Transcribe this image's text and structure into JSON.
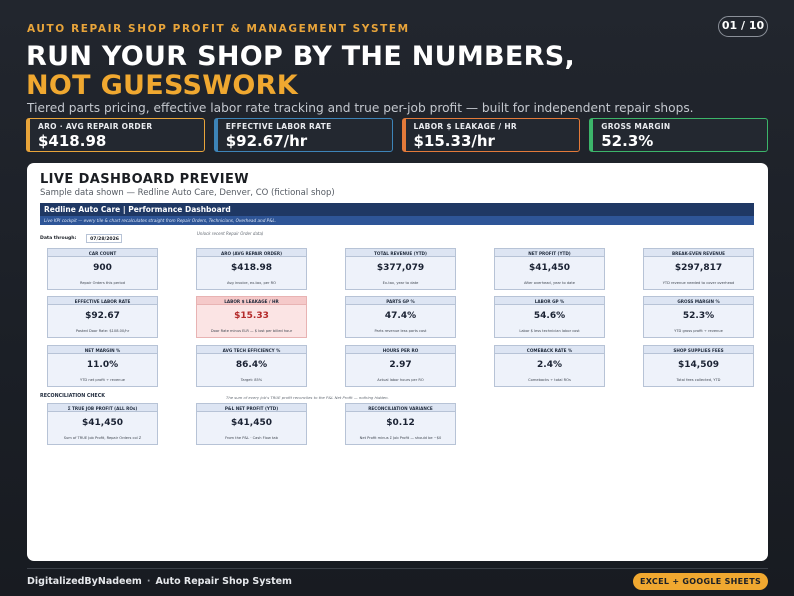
{
  "header": {
    "eyebrow": "AUTO REPAIR SHOP PROFIT & MANAGEMENT SYSTEM",
    "page_indicator": "01 / 10",
    "headline_line1": "RUN YOUR SHOP BY THE NUMBERS,",
    "headline_line2": "NOT GUESSWORK",
    "subhead": "Tiered parts pricing, effective labor rate tracking and true per-job profit — built for independent repair shops."
  },
  "kpis": [
    {
      "label": "ARO · AVG REPAIR ORDER",
      "value": "$418.98",
      "color": "#e8a43a"
    },
    {
      "label": "EFFECTIVE LABOR RATE",
      "value": "$92.67/hr",
      "color": "#3d84b8"
    },
    {
      "label": "LABOR $ LEAKAGE / HR",
      "value": "$15.33/hr",
      "color": "#e37a3a"
    },
    {
      "label": "GROSS MARGIN",
      "value": "52.3%",
      "color": "#3cb56a"
    }
  ],
  "panel": {
    "title": "LIVE DASHBOARD PREVIEW",
    "subtitle": "Sample data shown — Redline Auto Care, Denver, CO (fictional shop)",
    "dashboard_header": "Redline Auto Care  |  Performance Dashboard",
    "dashboard_subheader": "Live KPI cockpit — every tile & chart recalculates straight from Repair Orders, Technicians, Overhead and P&L.",
    "date_label": "Data through:",
    "date_value": "07/28/2026",
    "note_top": "Unlock recent Repair Order data)",
    "tiles": [
      {
        "label": "CAR COUNT",
        "value": "900",
        "note": "Repair Orders this period"
      },
      {
        "label": "ARO (AVG REPAIR ORDER)",
        "value": "$418.98",
        "note": "Avg invoice, ex-tax, per RO"
      },
      {
        "label": "TOTAL REVENUE (YTD)",
        "value": "$377,079",
        "note": "Ex-tax, year to date"
      },
      {
        "label": "NET PROFIT (YTD)",
        "value": "$41,450",
        "note": "After overhead, year to date"
      },
      {
        "label": "BREAK-EVEN REVENUE",
        "value": "$297,817",
        "note": "YTD revenue needed to cover overhead"
      },
      {
        "label": "EFFECTIVE LABOR RATE",
        "value": "$92.67",
        "note": "Posted Door Rate: $108.00/hr"
      },
      {
        "label": "LABOR $ LEAKAGE / HR",
        "value": "$15.33",
        "note": "Door Rate minus ELR — $ lost per billed hour"
      },
      {
        "label": "PARTS GP %",
        "value": "47.4%",
        "note": "Parts revenue less parts cost"
      },
      {
        "label": "LABOR GP %",
        "value": "54.6%",
        "note": "Labor $ less technician labor cost"
      },
      {
        "label": "GROSS MARGIN %",
        "value": "52.3%",
        "note": "YTD gross profit ÷ revenue"
      },
      {
        "label": "NET MARGIN %",
        "value": "11.0%",
        "note": "YTD net profit ÷ revenue"
      },
      {
        "label": "AVG TECH EFFICIENCY %",
        "value": "86.4%",
        "note": "Target: 85%"
      },
      {
        "label": "HOURS PER RO",
        "value": "2.97",
        "note": "Actual labor hours per RO"
      },
      {
        "label": "COMEBACK RATE %",
        "value": "2.4%",
        "note": "Comebacks ÷ total ROs"
      },
      {
        "label": "SHOP SUPPLIES FEES",
        "value": "$14,509",
        "note": "Total fees collected, YTD"
      }
    ],
    "recon_title": "RECONCILIATION CHECK",
    "recon_note": "The sum of every job's TRUE profit reconciles to the P&L Net Profit — nothing hidden.",
    "recon_tiles": [
      {
        "label": "Σ TRUE JOB PROFIT (ALL ROs)",
        "value": "$41,450",
        "note": "Sum of TRUE Job Profit, Repair Orders col Z"
      },
      {
        "label": "P&L NET PROFIT (YTD)",
        "value": "$41,450",
        "note": "From the P&L · Cash Flow tab"
      },
      {
        "label": "RECONCILIATION VARIANCE",
        "value": "$0.12",
        "note": "Net Profit minus Σ Job Profit — should be ~$0"
      }
    ]
  },
  "footer": {
    "brand": "DigitalizedByNadeem",
    "separator": "·",
    "system": "Auto Repair Shop System",
    "badge": "EXCEL + GOOGLE SHEETS"
  }
}
